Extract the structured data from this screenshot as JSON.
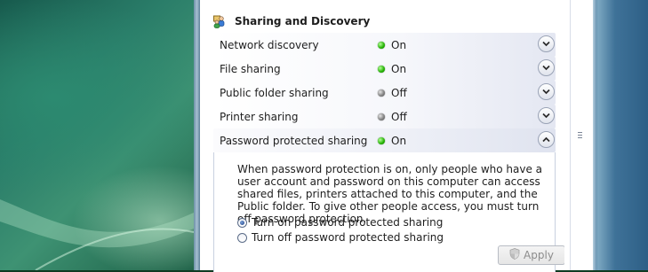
{
  "section": {
    "title": "Sharing and Discovery",
    "icon": "network-sharing-icon"
  },
  "rows": [
    {
      "label": "Network discovery",
      "status": "On",
      "state": "on",
      "expanded": false
    },
    {
      "label": "File sharing",
      "status": "On",
      "state": "on",
      "expanded": false
    },
    {
      "label": "Public folder sharing",
      "status": "Off",
      "state": "off",
      "expanded": false
    },
    {
      "label": "Printer sharing",
      "status": "Off",
      "state": "off",
      "expanded": false
    },
    {
      "label": "Password protected sharing",
      "status": "On",
      "state": "on",
      "expanded": true
    }
  ],
  "details": {
    "description": "When password protection is on, only people who have a user account and password on this computer can access shared files, printers attached to this computer, and the Public folder. To give other people access, you must turn off password protection.",
    "options": [
      {
        "label": "Turn on password protected sharing",
        "checked": true
      },
      {
        "label": "Turn off password protected sharing",
        "checked": false
      }
    ],
    "apply_label": "Apply",
    "apply_enabled": false
  },
  "colors": {
    "status_on": "#21b100",
    "status_off": "#7d7d7d"
  }
}
